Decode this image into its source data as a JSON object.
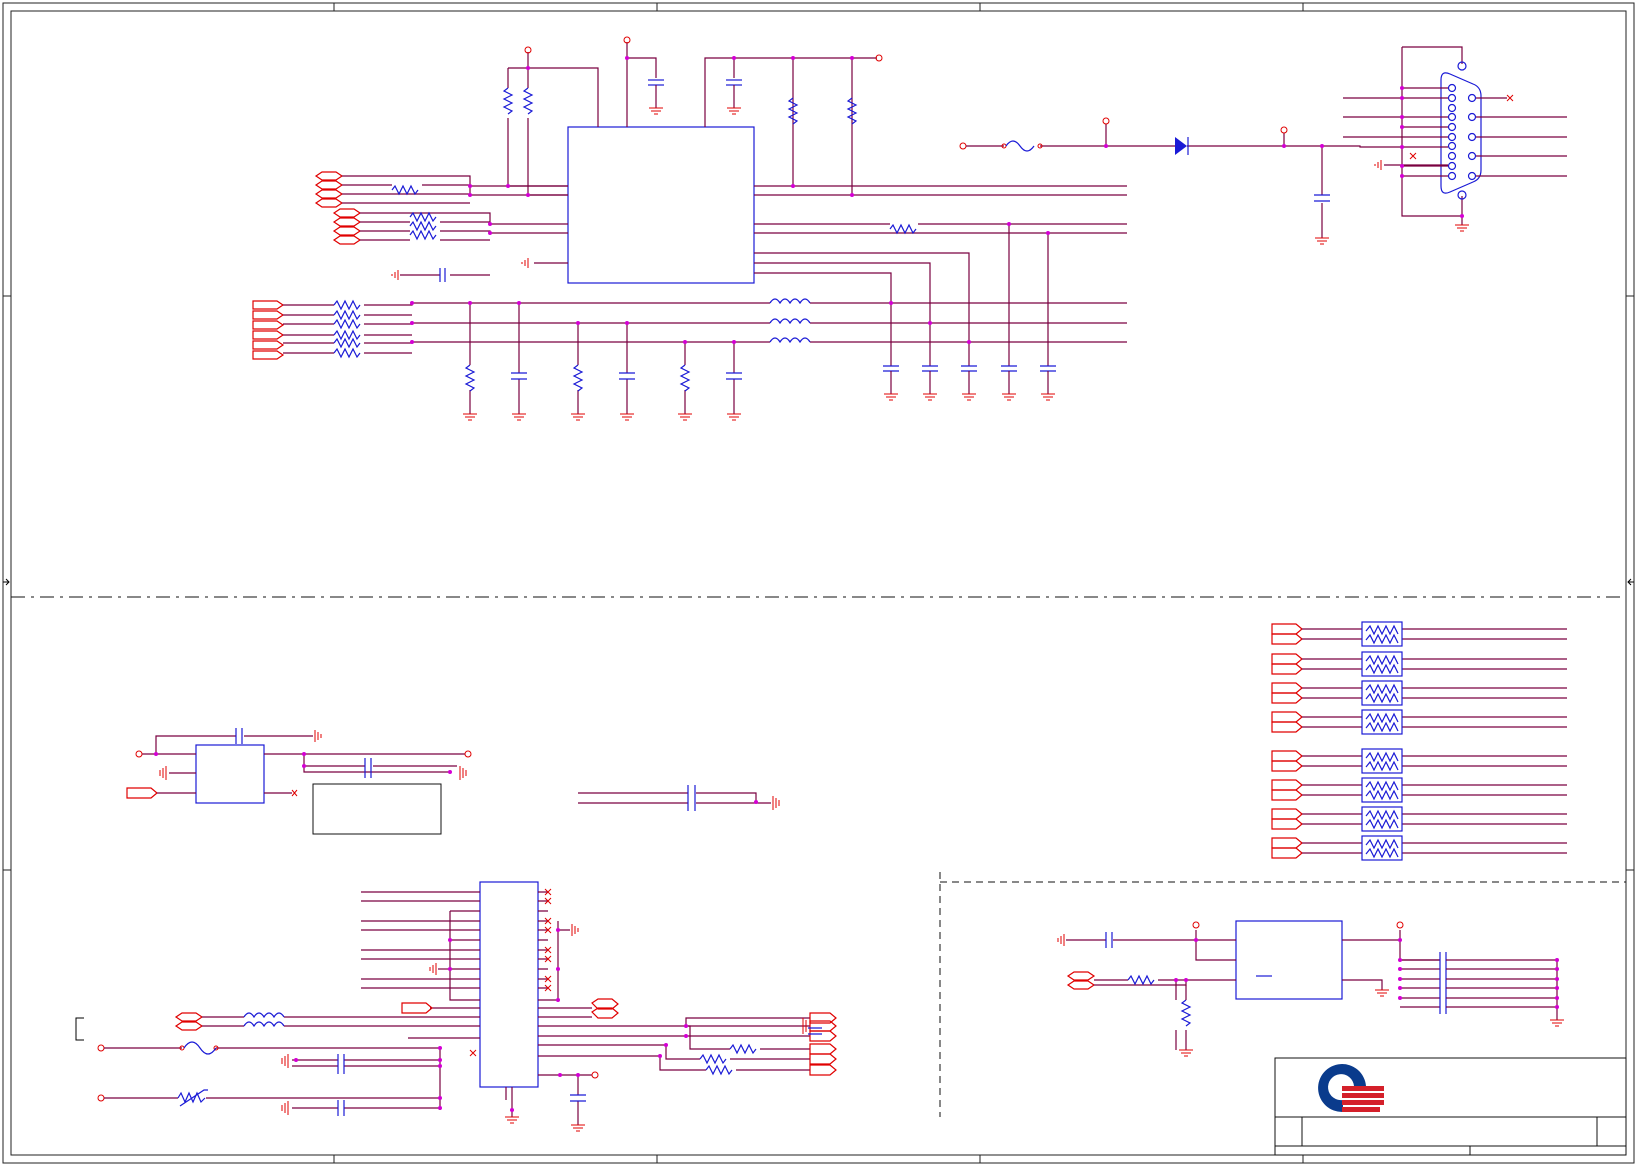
{
  "schematic": {
    "colors": {
      "wire_red": "#e00000",
      "wire_net": "#7a0040",
      "part_blue": "#1a1ad6",
      "junction": "#d400d4",
      "logo_blue": "#0a3b8c",
      "logo_red": "#d4202a"
    },
    "title_block": {
      "logo": "company-logo"
    }
  }
}
